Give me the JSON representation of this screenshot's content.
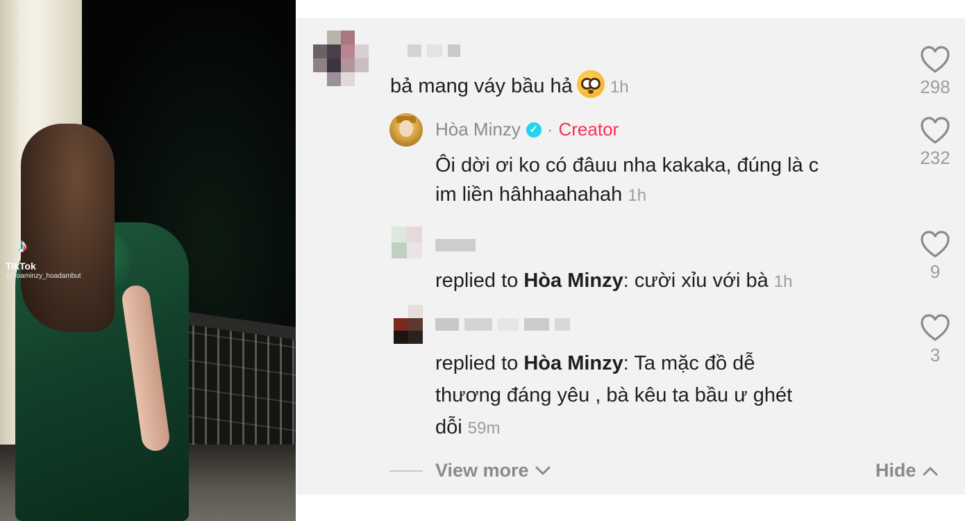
{
  "video": {
    "brand": "TikTok",
    "handle": "@hoaminzy_hoadambut"
  },
  "colors": {
    "accent_creator": "#fe2c55",
    "verified": "#20d5ec",
    "text_primary": "#1e1e1e",
    "text_secondary": "#8a8a8a",
    "panel_bg": "#f2f2f2"
  },
  "comments": [
    {
      "text": "bả mang váy bầu hả",
      "emoji": "flushed-face",
      "time": "1h",
      "likes": "298"
    },
    {
      "username": "Hòa Minzy",
      "badge": "·",
      "creator_label": "Creator",
      "lines": [
        "Ôi dời ơi ko có đâuu nha kakaka, đúng là c",
        "im liền hâhhaahahah"
      ],
      "time": "1h",
      "likes": "232"
    },
    {
      "reply_prefix": "replied to ",
      "reply_target": "Hòa Minzy",
      "reply_text": ": cười xỉu với bà",
      "time": "1h",
      "likes": "9"
    },
    {
      "reply_prefix": "replied to ",
      "reply_target": "Hòa Minzy",
      "lines": [
        ": Ta mặc đồ dễ",
        "thương đáng yêu , bà kêu ta bầu ư ghét",
        "dỗi"
      ],
      "time": "59m",
      "likes": "3"
    }
  ],
  "footer": {
    "view_more": "View more",
    "hide": "Hide"
  }
}
